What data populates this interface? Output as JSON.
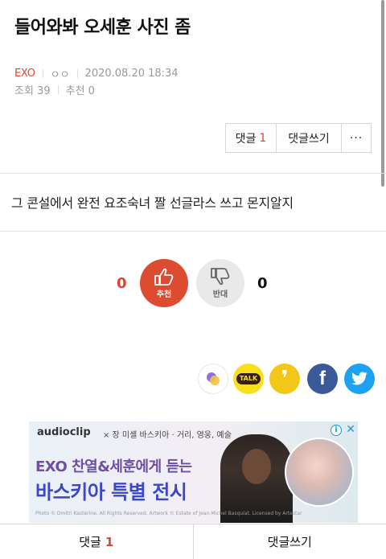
{
  "post": {
    "title": "들어와봐 오세훈 사진 좀",
    "category": "EXO",
    "author": "ㅇㅇ",
    "datetime": "2020.08.20 18:34",
    "views_label": "조회 39",
    "recommend_label": "추천 0",
    "body": "그 콘설에서 완전 요조숙녀 짤 선글라스 쓰고 몬지알지"
  },
  "actions": {
    "comment_label": "댓글",
    "comment_count": "1",
    "write_comment_label": "댓글쓰기",
    "more_label": "···"
  },
  "vote": {
    "up_count": "0",
    "up_label": "추천",
    "down_count": "0",
    "down_label": "반대"
  },
  "share": {
    "talk_label": "TALK",
    "quote_glyph": "❜",
    "fb_glyph": "f"
  },
  "ad": {
    "brand": "audioclip",
    "subtitle": "× 장 미셸 바스키아 · 거리, 영웅, 예술",
    "line1": "EXO 찬열&세훈에게 듣는",
    "line2": "바스키아 특별 전시",
    "fine": "Photo © Dmitri Kasterine. All Rights Reserved. Artwork © Estate of Jean-Michel Basquiat. Licensed by Artestar",
    "info": "i",
    "close": "✕"
  },
  "bottom": {
    "comment_label": "댓글",
    "comment_count": "1",
    "write_label": "댓글쓰기"
  },
  "colors": {
    "accent_red": "#e0442e",
    "facebook": "#3b5998",
    "twitter": "#1da1f2",
    "kakao": "#f7e01a"
  }
}
